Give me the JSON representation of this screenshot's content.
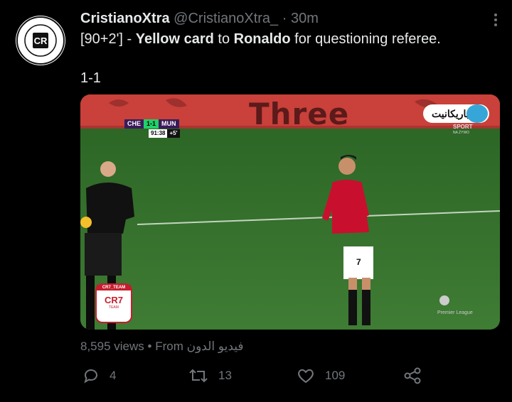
{
  "author": {
    "name": "CristianoXtra",
    "handle": "@CristianoXtra_",
    "time": "30m",
    "avatar": {
      "ring_text": "CRISTIANO XTRA",
      "center_text": "CR"
    }
  },
  "tweet": {
    "prefix": "[90+2'] - ",
    "bold_1": "Yellow card",
    "mid": " to ",
    "bold_2": "Ronaldo",
    "suffix": " for questioning referee.",
    "line2": "1-1"
  },
  "video": {
    "sponsor": "Three",
    "scoreboard": {
      "home": "CHE",
      "score": "1-1",
      "away": "MUN",
      "clock": "91:38",
      "added": "+5'"
    },
    "channel": {
      "name": "باريكانيت",
      "label": "SPORT",
      "sub": "NA ŻYWO"
    },
    "premier_league": "Premier League",
    "stamp": {
      "top": "CR7_TEAM",
      "main": "CR7",
      "bottom": "TEAM"
    },
    "player_number": "7"
  },
  "stats": {
    "views": "8,595 views",
    "sep": "•",
    "from_label": "From",
    "source": "فيديو الدون"
  },
  "actions": {
    "reply": {
      "icon": "reply-icon",
      "count": "4"
    },
    "retweet": {
      "icon": "retweet-icon",
      "count": "13"
    },
    "like": {
      "icon": "heart-icon",
      "count": "109"
    },
    "share": {
      "icon": "share-icon"
    }
  },
  "colors": {
    "bg": "#000000",
    "text": "#e7e9ea",
    "muted": "#71767b",
    "pitch": "#2f6a2b",
    "kit_red": "#c8102e"
  }
}
